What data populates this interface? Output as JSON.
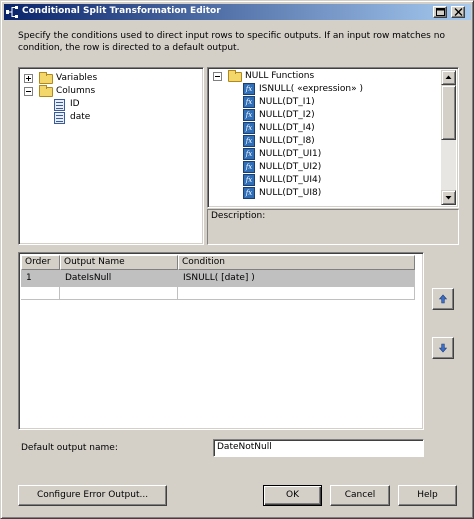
{
  "window": {
    "title": "Conditional Split Transformation Editor",
    "description": "Specify the conditions used to direct input rows to specific outputs. If an input row matches no condition, the row is directed to a default output."
  },
  "variables_tree": {
    "items": [
      {
        "label": "Variables",
        "expander": "+",
        "icon": "folder-icon",
        "indent": 0
      },
      {
        "label": "Columns",
        "expander": "-",
        "icon": "folder-icon",
        "indent": 0
      },
      {
        "label": "ID",
        "icon": "column-icon",
        "indent": 1
      },
      {
        "label": "date",
        "icon": "column-icon",
        "indent": 1
      }
    ]
  },
  "functions_tree": {
    "root": {
      "label": "NULL Functions",
      "expander": "-",
      "icon": "folder-icon"
    },
    "items": [
      {
        "label": "ISNULL( «expression» )",
        "icon": "function-icon"
      },
      {
        "label": "NULL(DT_I1)",
        "icon": "function-icon"
      },
      {
        "label": "NULL(DT_I2)",
        "icon": "function-icon"
      },
      {
        "label": "NULL(DT_I4)",
        "icon": "function-icon"
      },
      {
        "label": "NULL(DT_I8)",
        "icon": "function-icon"
      },
      {
        "label": "NULL(DT_UI1)",
        "icon": "function-icon"
      },
      {
        "label": "NULL(DT_UI2)",
        "icon": "function-icon"
      },
      {
        "label": "NULL(DT_UI4)",
        "icon": "function-icon"
      },
      {
        "label": "NULL(DT_UI8)",
        "icon": "function-icon"
      }
    ]
  },
  "description_panel": {
    "label": "Description:"
  },
  "conditions_grid": {
    "headers": [
      "Order",
      "Output Name",
      "Condition"
    ],
    "rows": [
      {
        "order": "1",
        "output_name": "DateIsNull",
        "condition": "ISNULL( [date] )"
      }
    ]
  },
  "default_output": {
    "label": "Default output name:",
    "value": "DateNotNull"
  },
  "buttons": {
    "configure_error_output": "Configure Error Output...",
    "ok": "OK",
    "cancel": "Cancel",
    "help": "Help"
  },
  "colors": {
    "titlebar_start": "#0a246a",
    "titlebar_end": "#a6caf0",
    "dialog_face": "#d4d0c8",
    "selected_row": "#c0c0c0",
    "move_arrow": "#3d6ec4"
  }
}
